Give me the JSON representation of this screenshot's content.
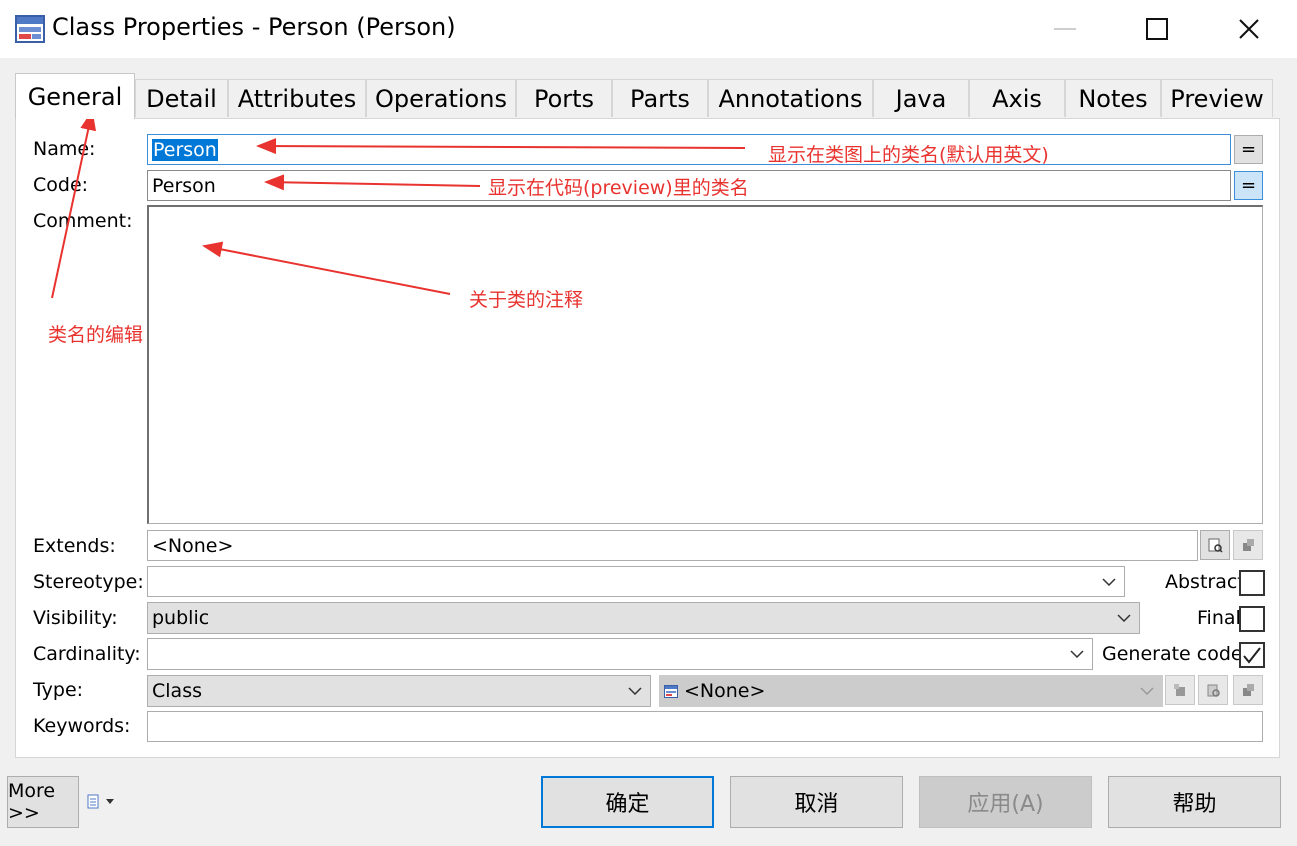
{
  "window": {
    "title": "Class Properties - Person (Person)",
    "controls": [
      "minimize",
      "maximize",
      "close"
    ]
  },
  "tabs": [
    {
      "label": "General",
      "active": true
    },
    {
      "label": "Detail"
    },
    {
      "label": "Attributes"
    },
    {
      "label": "Operations"
    },
    {
      "label": "Ports"
    },
    {
      "label": "Parts"
    },
    {
      "label": "Annotations"
    },
    {
      "label": "Java"
    },
    {
      "label": "Axis"
    },
    {
      "label": "Notes"
    },
    {
      "label": "Preview"
    }
  ],
  "form": {
    "name": {
      "label": "Name:",
      "value": "Person",
      "button": "="
    },
    "code": {
      "label": "Code:",
      "value": "Person",
      "button": "="
    },
    "comment": {
      "label": "Comment:",
      "value": ""
    },
    "extends": {
      "label": "Extends:",
      "value": "<None>"
    },
    "stereotype": {
      "label": "Stereotype:",
      "value": ""
    },
    "visibility": {
      "label": "Visibility:",
      "value": "public"
    },
    "cardinality": {
      "label": "Cardinality:",
      "value": ""
    },
    "type": {
      "label": "Type:",
      "value": "Class",
      "classifier_value": "<None>"
    },
    "keywords": {
      "label": "Keywords:",
      "value": ""
    },
    "abstract": {
      "label": "Abstract",
      "checked": false
    },
    "final": {
      "label": "Final",
      "checked": false
    },
    "generate_code": {
      "label": "Generate code",
      "checked": true
    }
  },
  "annotations": {
    "name_note": "显示在类图上的类名(默认用英文)",
    "code_note": "显示在代码(preview)里的类名",
    "comment_note": "关于类的注释",
    "tab_note": "类名的编辑",
    "color": "#e8332f"
  },
  "footer": {
    "more": "More >>",
    "ok": "确定",
    "cancel": "取消",
    "apply": "应用(A)",
    "help": "帮助"
  },
  "colors": {
    "selection": "#0078d7",
    "focus_border": "#3c8fd8",
    "annotation": "#e8332f"
  }
}
